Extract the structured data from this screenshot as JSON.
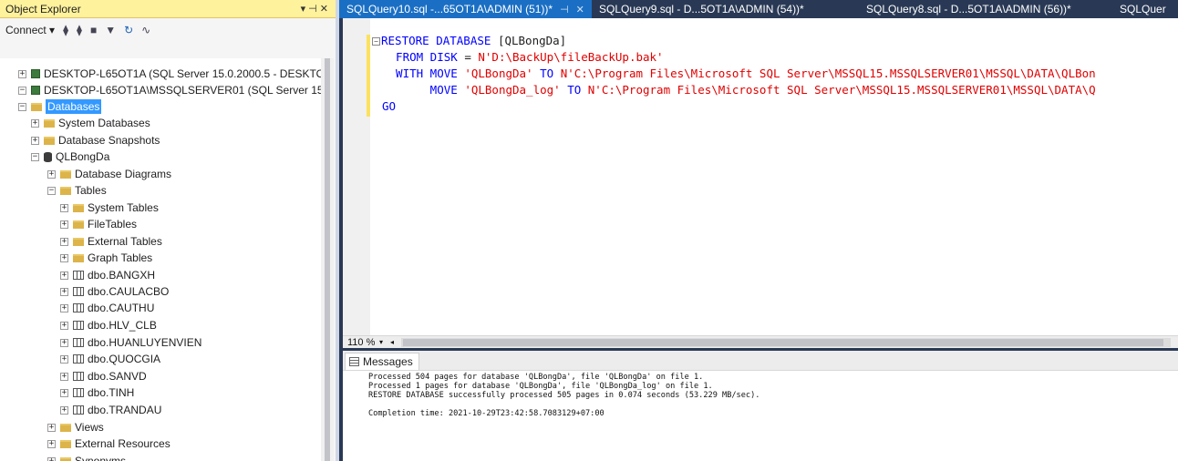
{
  "object_explorer": {
    "title": "Object Explorer",
    "title_controls": "▾ ⊣ ✕",
    "toolbar": {
      "connect_label": "Connect ▾"
    },
    "tree": [
      {
        "expander": "⊞",
        "icon": "server",
        "label": "DESKTOP-L65OT1A (SQL Server 15.0.2000.5 - DESKTO",
        "level": 0
      },
      {
        "expander": "⊟",
        "icon": "server",
        "label": "DESKTOP-L65OT1A\\MSSQLSERVER01 (SQL Server 15",
        "level": 0
      },
      {
        "expander": "⊟",
        "icon": "folder",
        "label": "Databases",
        "level": 1,
        "selected": true
      },
      {
        "expander": "⊞",
        "icon": "folder",
        "label": "System Databases",
        "level": 2
      },
      {
        "expander": "⊞",
        "icon": "folder",
        "label": "Database Snapshots",
        "level": 2
      },
      {
        "expander": "⊟",
        "icon": "database",
        "label": "QLBongDa",
        "level": 2
      },
      {
        "expander": "⊞",
        "icon": "folder",
        "label": "Database Diagrams",
        "level": 3
      },
      {
        "expander": "⊟",
        "icon": "folder",
        "label": "Tables",
        "level": 3
      },
      {
        "expander": "⊞",
        "icon": "folder",
        "label": "System Tables",
        "level": 4
      },
      {
        "expander": "⊞",
        "icon": "folder",
        "label": "FileTables",
        "level": 4
      },
      {
        "expander": "⊞",
        "icon": "folder",
        "label": "External Tables",
        "level": 4
      },
      {
        "expander": "⊞",
        "icon": "folder",
        "label": "Graph Tables",
        "level": 4
      },
      {
        "expander": "⊞",
        "icon": "table",
        "label": "dbo.BANGXH",
        "level": 4
      },
      {
        "expander": "⊞",
        "icon": "table",
        "label": "dbo.CAULACBO",
        "level": 4
      },
      {
        "expander": "⊞",
        "icon": "table",
        "label": "dbo.CAUTHU",
        "level": 4
      },
      {
        "expander": "⊞",
        "icon": "table",
        "label": "dbo.HLV_CLB",
        "level": 4
      },
      {
        "expander": "⊞",
        "icon": "table",
        "label": "dbo.HUANLUYENVIEN",
        "level": 4
      },
      {
        "expander": "⊞",
        "icon": "table",
        "label": "dbo.QUOCGIA",
        "level": 4
      },
      {
        "expander": "⊞",
        "icon": "table",
        "label": "dbo.SANVD",
        "level": 4
      },
      {
        "expander": "⊞",
        "icon": "table",
        "label": "dbo.TINH",
        "level": 4
      },
      {
        "expander": "⊞",
        "icon": "table",
        "label": "dbo.TRANDAU",
        "level": 4
      },
      {
        "expander": "⊞",
        "icon": "folder",
        "label": "Views",
        "level": 3
      },
      {
        "expander": "⊞",
        "icon": "folder",
        "label": "External Resources",
        "level": 3
      },
      {
        "expander": "⊞",
        "icon": "folder",
        "label": "Synonyms",
        "level": 3
      }
    ]
  },
  "tabs": [
    {
      "label": "SQLQuery10.sql -...65OT1A\\ADMIN (51))*",
      "active": true,
      "pin": "⊣",
      "close": "✕"
    },
    {
      "label": "SQLQuery9.sql - D...5OT1A\\ADMIN (54))*",
      "active": false
    },
    {
      "label": "SQLQuery8.sql - D...5OT1A\\ADMIN (56))*",
      "active": false
    },
    {
      "label": "SQLQuer",
      "active": false
    }
  ],
  "editor": {
    "lines": [
      [
        {
          "t": "RESTORE DATABASE ",
          "c": "kw"
        },
        {
          "t": "[QLBongDa]",
          "c": "pl"
        }
      ],
      [
        {
          "t": "  FROM DISK ",
          "c": "kw"
        },
        {
          "t": "= ",
          "c": "pl"
        },
        {
          "t": "N'D:\\BackUp\\fileBackUp.bak'",
          "c": "str"
        }
      ],
      [
        {
          "t": "  WITH MOVE ",
          "c": "kw"
        },
        {
          "t": "'QLBongDa'",
          "c": "str"
        },
        {
          "t": " TO ",
          "c": "kw"
        },
        {
          "t": "N'C:\\Program Files\\Microsoft SQL Server\\MSSQL15.MSSQLSERVER01\\MSSQL\\DATA\\QLBon",
          "c": "str"
        }
      ],
      [
        {
          "t": "       MOVE ",
          "c": "kw"
        },
        {
          "t": "'QLBongDa_log'",
          "c": "str"
        },
        {
          "t": " TO ",
          "c": "kw"
        },
        {
          "t": "N'C:\\Program Files\\Microsoft SQL Server\\MSSQL15.MSSQLSERVER01\\MSSQL\\DATA\\Q",
          "c": "str"
        }
      ],
      [
        {
          "t": "GO",
          "c": "kw"
        }
      ]
    ],
    "fold_marker": "−"
  },
  "statusbar": {
    "zoom": "110 %"
  },
  "results": {
    "tab_label": "Messages",
    "lines": [
      "Processed 504 pages for database 'QLBongDa', file 'QLBongDa' on file 1.",
      "Processed 1 pages for database 'QLBongDa', file 'QLBongDa_log' on file 1.",
      "RESTORE DATABASE successfully processed 505 pages in 0.074 seconds (53.229 MB/sec).",
      "",
      "Completion time: 2021-10-29T23:42:58.7083129+07:00"
    ]
  },
  "colors": {
    "title_bar": "#fff29d",
    "chrome": "#293955",
    "active_tab": "#1a6fc4",
    "keyword": "#0000ff",
    "string": "#e00000",
    "selection": "#3399ff"
  }
}
